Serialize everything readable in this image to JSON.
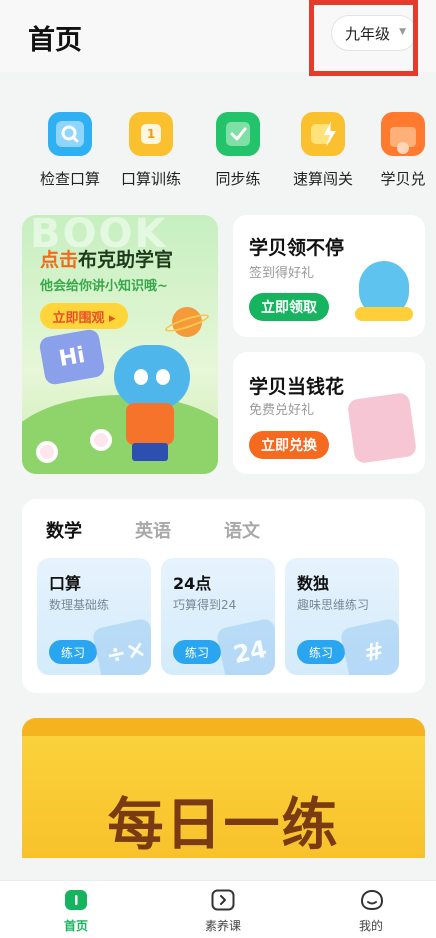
{
  "header": {
    "title": "首页",
    "grade": "九年级"
  },
  "quick_actions": [
    {
      "label": "检查口算",
      "icon": "search-icon",
      "color": "#2fb0f2"
    },
    {
      "label": "口算训练",
      "icon": "calendar-icon",
      "color": "#fbc02d",
      "glyph": "1"
    },
    {
      "label": "同步练",
      "icon": "bookmark-check-icon",
      "color": "#22c36a"
    },
    {
      "label": "速算闯关",
      "icon": "lightning-icon",
      "color": "#fbc02d"
    },
    {
      "label": "学贝兑",
      "icon": "gift-icon",
      "color": "#ff7a2e"
    }
  ],
  "banner": {
    "bg_text": "BOOK",
    "title_highlight": "点击",
    "title_rest": "布克助学官",
    "subtitle": "他会给你讲小知识哦~",
    "button": "立即围观 ▸",
    "hi": "Hi"
  },
  "cards": [
    {
      "title": "学贝领不停",
      "subtitle": "签到得好礼",
      "button": "立即领取",
      "button_color": "#16b45e"
    },
    {
      "title": "学贝当钱花",
      "subtitle": "免费兑好礼",
      "button": "立即兑换",
      "button_color": "#f56a1e"
    }
  ],
  "subjects": {
    "tabs": [
      "数学",
      "英语",
      "语文"
    ],
    "active_tab": 0,
    "practice": [
      {
        "title": "口算",
        "subtitle": "数理基础练",
        "button": "练习",
        "art": "÷×"
      },
      {
        "title": "24点",
        "subtitle": "巧算得到24",
        "button": "练习",
        "art": "24"
      },
      {
        "title": "数独",
        "subtitle": "趣味思维练习",
        "button": "练习",
        "art": "#"
      }
    ]
  },
  "daily": {
    "title": "每日一练"
  },
  "bottom_nav": [
    {
      "label": "首页",
      "icon": "home-book-icon",
      "active": true
    },
    {
      "label": "素养课",
      "icon": "play-icon",
      "active": false
    },
    {
      "label": "我的",
      "icon": "profile-icon",
      "active": false
    }
  ]
}
